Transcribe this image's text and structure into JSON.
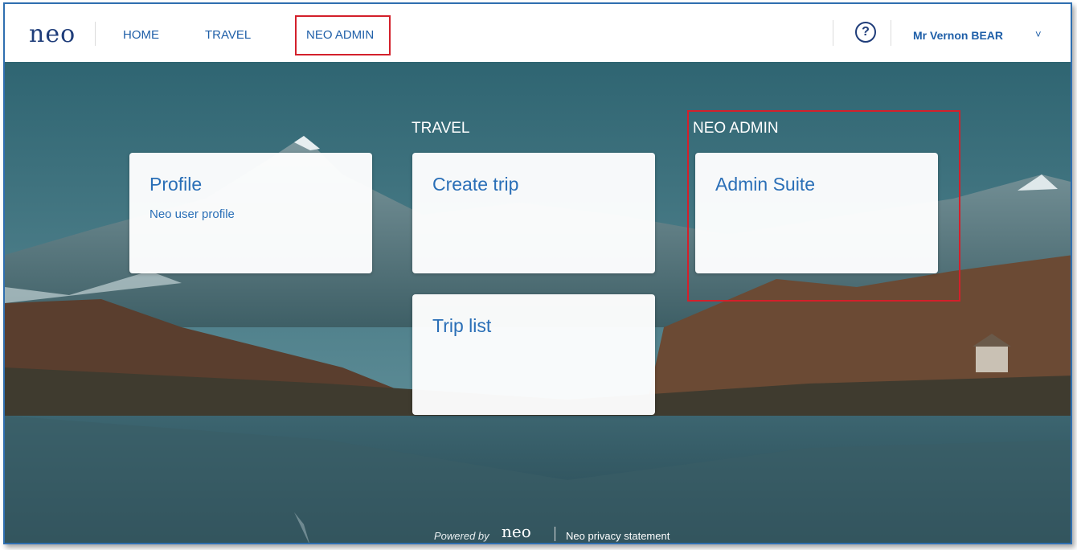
{
  "navbar": {
    "logo": "neo",
    "items": [
      {
        "label": "HOME"
      },
      {
        "label": "TRAVEL"
      },
      {
        "label": "NEO ADMIN"
      }
    ],
    "help_symbol": "?",
    "help_icon": "help-circle-icon",
    "user_name": "Mr Vernon BEAR",
    "user_chevron": "˅",
    "chevron_icon": "chevron-down-icon"
  },
  "sections": {
    "travel_label": "TRAVEL",
    "admin_label": "NEO ADMIN"
  },
  "cards": {
    "profile": {
      "title": "Profile",
      "subtitle": "Neo user profile"
    },
    "create_trip": {
      "title": "Create trip"
    },
    "trip_list": {
      "title": "Trip list"
    },
    "admin_suite": {
      "title": "Admin Suite"
    }
  },
  "footer": {
    "powered_by": "Powered by",
    "powered_logo": "neo",
    "privacy": "Neo privacy statement"
  },
  "colors": {
    "link_blue": "#2a6fb7",
    "brand_navy": "#1f3d7a",
    "highlight_red": "#d3202b"
  }
}
